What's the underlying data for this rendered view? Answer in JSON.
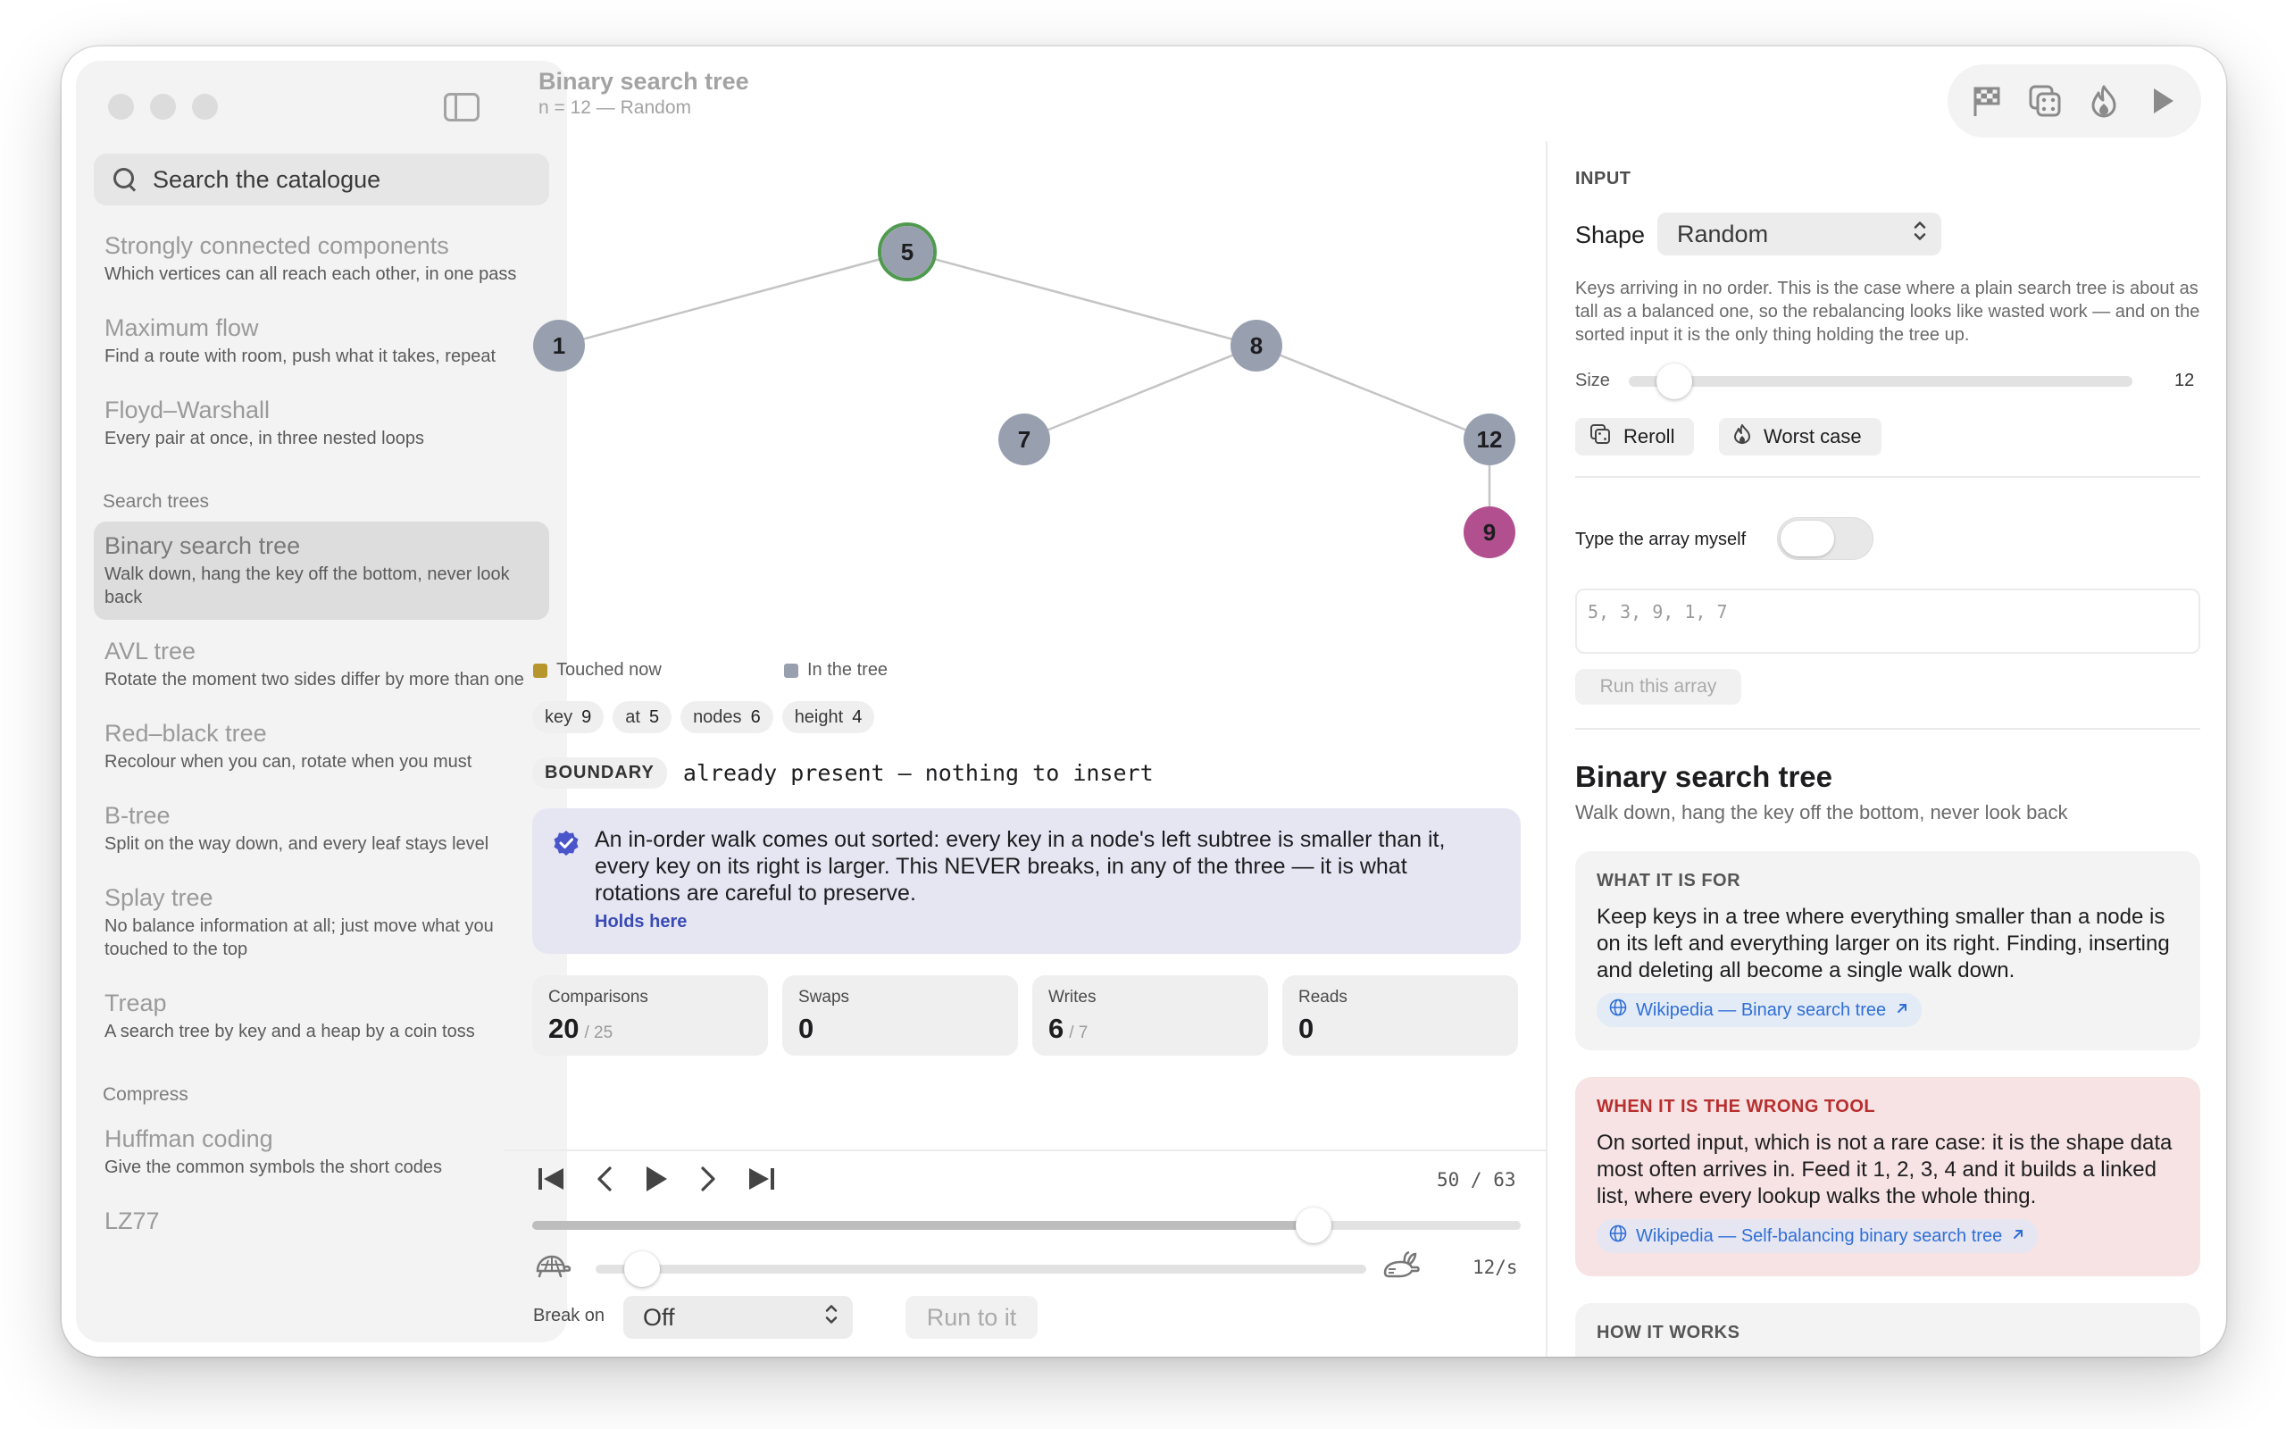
{
  "header": {
    "title": "Binary search tree",
    "subtitle": "n = 12 — Random"
  },
  "search": {
    "placeholder": "Search the catalogue"
  },
  "sidebar": {
    "items": [
      {
        "title": "Strongly connected components",
        "desc": "Which vertices can all reach each other, in one pass"
      },
      {
        "title": "Maximum flow",
        "desc": "Find a route with room, push what it takes, repeat"
      },
      {
        "title": "Floyd–Warshall",
        "desc": "Every pair at once, in three nested loops"
      }
    ],
    "section_search_trees": "Search trees",
    "tree_items": [
      {
        "title": "Binary search tree",
        "desc": "Walk down, hang the key off the bottom, never look back"
      },
      {
        "title": "AVL tree",
        "desc": "Rotate the moment two sides differ by more than one"
      },
      {
        "title": "Red–black tree",
        "desc": "Recolour when you can, rotate when you must"
      },
      {
        "title": "B-tree",
        "desc": "Split on the way down, and every leaf stays level"
      },
      {
        "title": "Splay tree",
        "desc": "No balance information at all; just move what you touched to the top"
      },
      {
        "title": "Treap",
        "desc": "A search tree by key and a heap by a coin toss"
      }
    ],
    "section_compress": "Compress",
    "compress_items": [
      {
        "title": "Huffman coding",
        "desc": "Give the common symbols the short codes"
      },
      {
        "title": "LZ77",
        "desc": ""
      }
    ]
  },
  "toolbar": {
    "icons": [
      "flag-icon",
      "dice-icon",
      "flame-icon",
      "play-icon"
    ]
  },
  "tree": {
    "nodes": [
      {
        "label": "5",
        "state": "tree",
        "highlight": "found"
      },
      {
        "label": "1",
        "state": "tree"
      },
      {
        "label": "8",
        "state": "tree"
      },
      {
        "label": "7",
        "state": "tree"
      },
      {
        "label": "12",
        "state": "tree"
      },
      {
        "label": "9",
        "state": "new"
      }
    ],
    "edges": [
      [
        "5",
        "1"
      ],
      [
        "5",
        "8"
      ],
      [
        "8",
        "7"
      ],
      [
        "8",
        "12"
      ],
      [
        "12",
        "9"
      ]
    ],
    "colors": {
      "tree": "#98a0b0",
      "new": "#b2508f",
      "found_ring": "#4f9a4e",
      "touched": "#b8962e",
      "edge": "#c4c4c4"
    }
  },
  "legend": {
    "touched": "Touched now",
    "in_tree": "In the tree"
  },
  "chips": [
    {
      "label": "key",
      "value": "9"
    },
    {
      "label": "at",
      "value": "5"
    },
    {
      "label": "nodes",
      "value": "6"
    },
    {
      "label": "height",
      "value": "4"
    }
  ],
  "boundary": {
    "badge": "BOUNDARY",
    "text": "already present — nothing to insert"
  },
  "invariant": {
    "text": "An in-order walk comes out sorted: every key in a node's left subtree is smaller than it, every key on its right is larger. This NEVER breaks, in any of the three — it is what rotations are careful to preserve.",
    "link": "Holds here"
  },
  "stats": [
    {
      "label": "Comparisons",
      "value": "20",
      "of": "/ 25"
    },
    {
      "label": "Swaps",
      "value": "0",
      "of": ""
    },
    {
      "label": "Writes",
      "value": "6",
      "of": "/ 7"
    },
    {
      "label": "Reads",
      "value": "0",
      "of": ""
    }
  ],
  "playback": {
    "frame": "50 / 63",
    "progress": 0.79,
    "speed": "12/s",
    "speed_fraction": 0.06
  },
  "break_on": {
    "label": "Break on",
    "value": "Off",
    "run_button": "Run to it"
  },
  "input": {
    "section_label": "INPUT",
    "shape_label": "Shape",
    "shape_value": "Random",
    "description": "Keys arriving in no order. This is the case where a plain search tree is about as tall as a balanced one, so the rebalancing looks like wasted work — and on the sorted input it is the only thing holding the tree up.",
    "size_label": "Size",
    "size_value": "12",
    "size_fraction": 0.09,
    "reroll": "Reroll",
    "worst_case": "Worst case",
    "type_label": "Type the array myself",
    "array_placeholder": "5, 3, 9, 1, 7",
    "run_array": "Run this array"
  },
  "info": {
    "title": "Binary search tree",
    "subtitle": "Walk down, hang the key off the bottom, never look back",
    "what_head": "WHAT IT IS FOR",
    "what_body": "Keep keys in a tree where everything smaller than a node is on its left and everything larger on its right. Finding, inserting and deleting all become a single walk down.",
    "what_link": "Wikipedia — Binary search tree",
    "wrong_head": "WHEN IT IS THE WRONG TOOL",
    "wrong_body": "On sorted input, which is not a rare case: it is the shape data most often arrives in. Feed it 1, 2, 3, 4 and it builds a linked list, where every lookup walks the whole thing.",
    "wrong_link": "Wikipedia — Self-balancing binary search tree",
    "how_head": "HOW IT WORKS"
  }
}
